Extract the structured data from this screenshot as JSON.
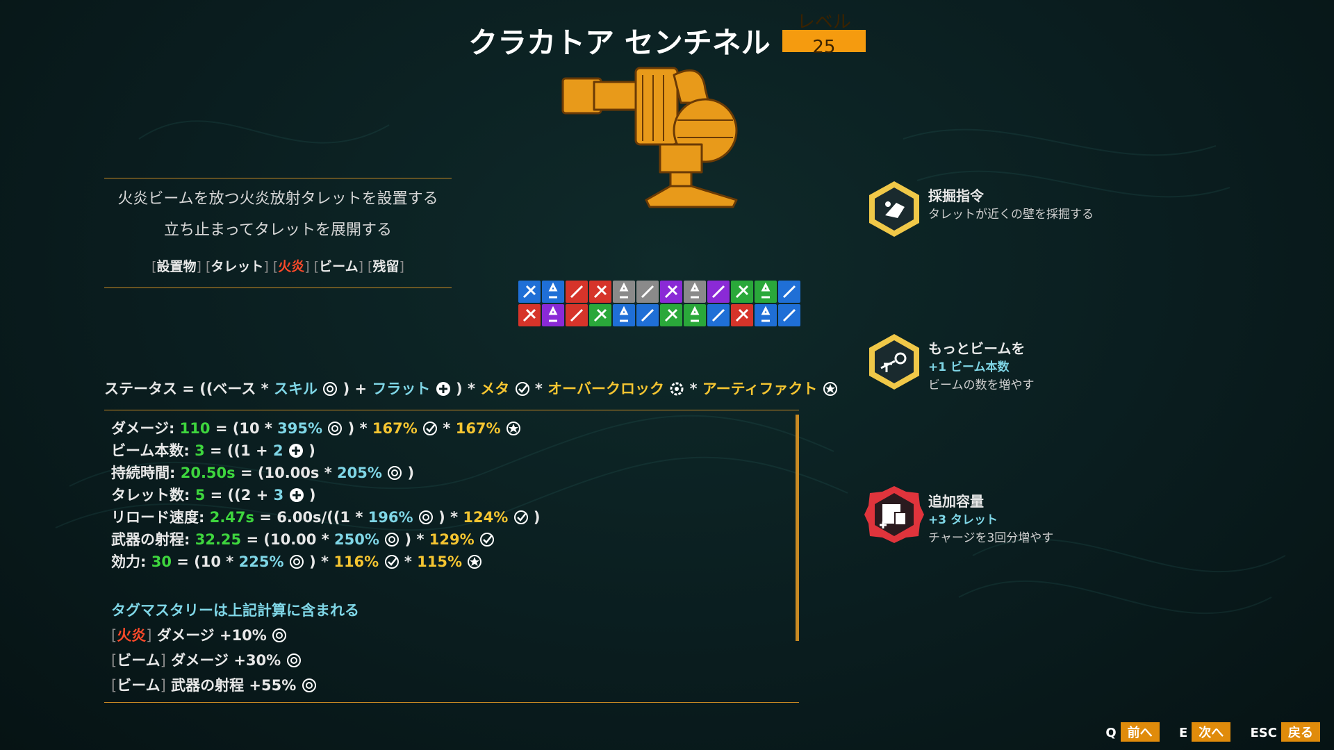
{
  "header": {
    "title": "クラカトア センチネル",
    "level_label": "レベル",
    "level_value": "25"
  },
  "description": {
    "lines": [
      "火炎ビームを放つ火炎放射タレットを設置する",
      "立ち止まってタレットを展開する"
    ],
    "tags": [
      "設置物",
      "タレット",
      "火炎",
      "ビーム",
      "残留"
    ]
  },
  "formula": {
    "prefix": "ステータス = ((ベース * ",
    "skill": "スキル",
    "plus": " ) + ",
    "flat": "フラット",
    "times": " ) * ",
    "meta": "メタ",
    "star": " * ",
    "overclock": "オーバークロック",
    "artifact": "アーティファクト"
  },
  "stats": [
    {
      "label": "ダメージ:",
      "value": "110",
      "expr1": " = (10 * ",
      "pct1": "395%",
      "expr2": " ) * ",
      "pct2": "167%",
      "expr3": " * ",
      "pct3": "167%"
    },
    {
      "label": "ビーム本数:",
      "value": "3",
      "expr1": " = ((1 + ",
      "pct1": "2",
      "expr2": " )"
    },
    {
      "label": "持続時間:",
      "value": "20.50s",
      "expr1": " = (10.00s * ",
      "pct1": "205%",
      "expr2": " )"
    },
    {
      "label": "タレット数:",
      "value": "5",
      "expr1": " = ((2 + ",
      "pct1": "3",
      "expr2": " )"
    },
    {
      "label": "リロード速度:",
      "value": "2.47s",
      "expr1": " = 6.00s/((1 * ",
      "pct1": "196%",
      "expr2": " ) * ",
      "pct2": "124%",
      "expr3": " )"
    },
    {
      "label": "武器の射程:",
      "value": "32.25",
      "expr1": " = (10.00 * ",
      "pct1": "250%",
      "expr2": " ) * ",
      "pct2": "129%"
    },
    {
      "label": "効力:",
      "value": "30",
      "expr1": " = (10 * ",
      "pct1": "225%",
      "expr2": " ) * ",
      "pct2": "116%",
      "expr3": " * ",
      "pct3": "115%"
    }
  ],
  "mastery": {
    "heading": "タグマスタリーは上記計算に含まれる",
    "items": [
      {
        "tag": "火炎",
        "text": "ダメージ +10%"
      },
      {
        "tag": "ビーム",
        "text": "ダメージ +30%"
      },
      {
        "tag": "ビーム",
        "text": "武器の射程 +55%"
      }
    ]
  },
  "abilities": [
    {
      "name": "採掘指令",
      "desc": "タレットが近くの壁を採掘する",
      "color": "#f0c848"
    },
    {
      "name": "もっとビームを",
      "bonus": "+1 ビーム本数",
      "desc": "ビームの数を増やす",
      "color": "#f0c848"
    },
    {
      "name": "追加容量",
      "bonus": "+3 タレット",
      "desc": "チャージを3回分増やす",
      "color": "#e0343c"
    }
  ],
  "nav": [
    {
      "key": "Q",
      "label": "前へ"
    },
    {
      "key": "E",
      "label": "次へ"
    },
    {
      "key": "ESC",
      "label": "戻る"
    }
  ],
  "colors": {
    "accent": "#e08b0b",
    "gold": "#f5c531",
    "cyan": "#7fd6e6",
    "green": "#3ed63e",
    "fire": "#ff4a2a"
  }
}
